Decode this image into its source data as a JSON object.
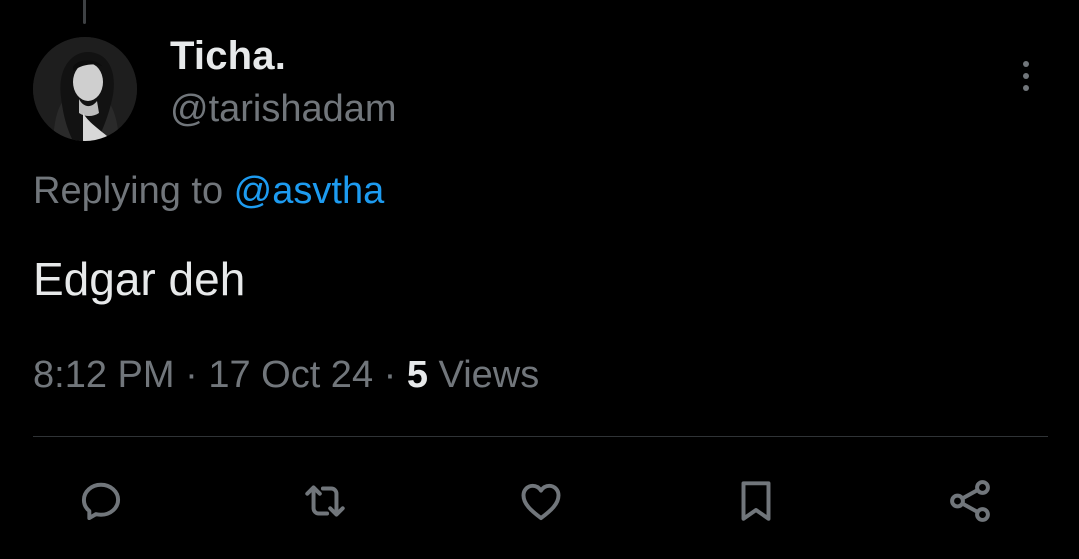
{
  "author": {
    "display_name": "Ticha.",
    "handle": "@tarishadam"
  },
  "reply_context": {
    "prefix": "Replying to ",
    "mention": "@asvtha"
  },
  "tweet": {
    "text": "Edgar deh"
  },
  "meta": {
    "time": "8:12 PM",
    "separator": " · ",
    "date": "17 Oct 24",
    "views_count": "5",
    "views_label": " Views"
  },
  "actions": [
    "reply-icon",
    "retweet-icon",
    "like-icon",
    "bookmark-icon",
    "share-icon"
  ],
  "colors": {
    "background": "#000000",
    "text_primary": "#e7e9ea",
    "text_secondary": "#71767b",
    "accent_link": "#1d9bf0",
    "divider": "#2f3336"
  }
}
